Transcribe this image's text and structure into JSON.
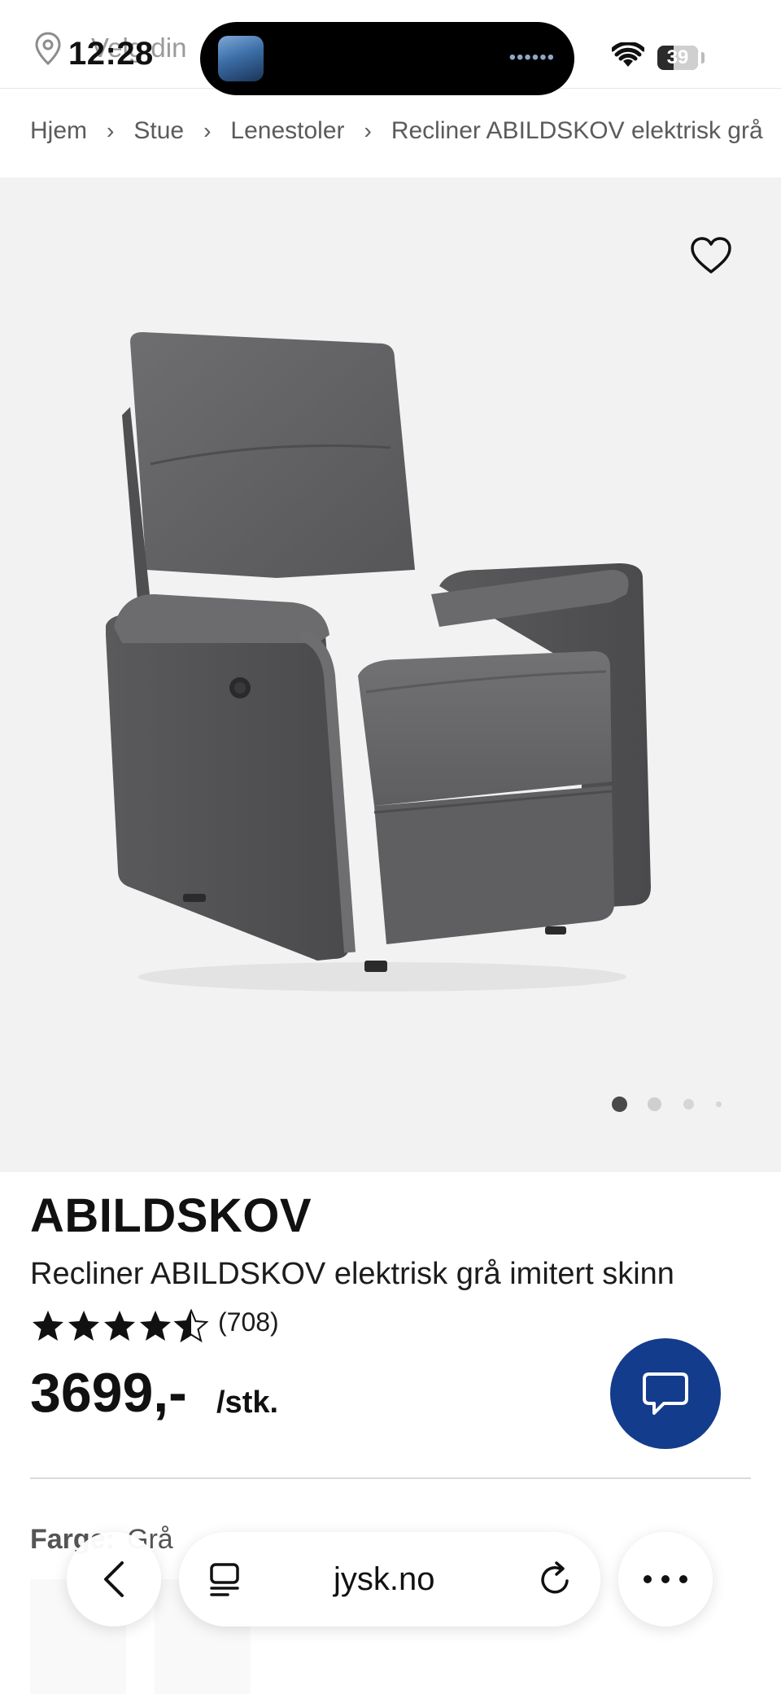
{
  "status_bar": {
    "time": "12:28",
    "location_prompt": "Velg din",
    "battery": "39",
    "media_dots": "••••••"
  },
  "breadcrumb": [
    "Hjem",
    "Stue",
    "Lenestoler",
    "Recliner ABILDSKOV elektrisk grå"
  ],
  "gallery": {
    "active_slide": 1,
    "slide_count": 4
  },
  "product": {
    "brand": "ABILDSKOV",
    "title": "Recliner ABILDSKOV elektrisk grå imitert skinn",
    "rating": 4.5,
    "rating_max": 5,
    "review_count": "(708)",
    "price": "3699,-",
    "unit": "/stk.",
    "color_label": "Farge:",
    "color_value": "Grå"
  },
  "browser": {
    "url": "jysk.no"
  },
  "colors": {
    "accent": "#143c8c",
    "text": "#111111",
    "gallery_bg": "#f2f2f2"
  }
}
